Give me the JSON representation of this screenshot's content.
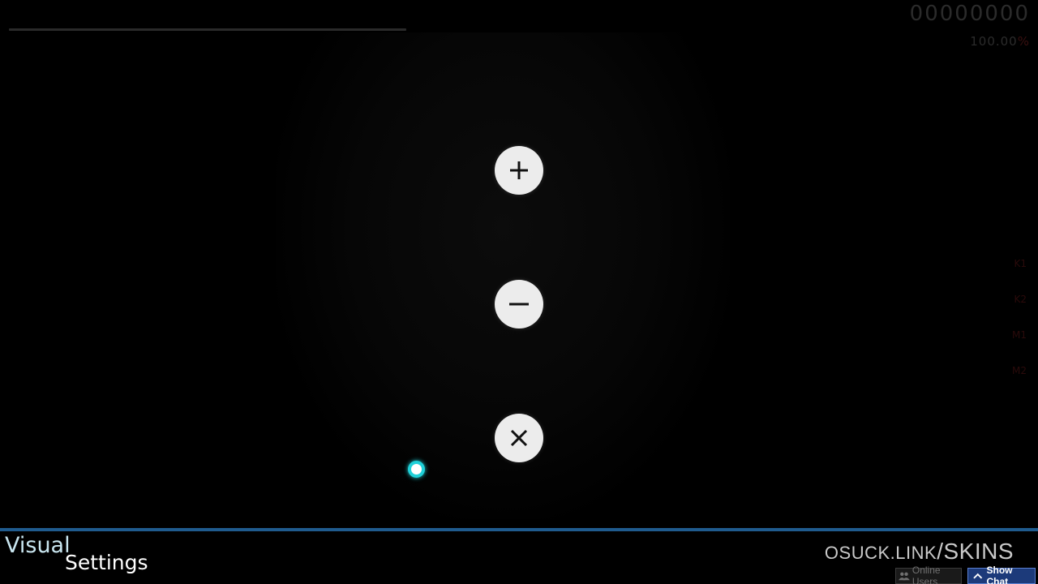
{
  "hud": {
    "score": "00000000",
    "accuracy_number": "100.00",
    "accuracy_symbol": "%",
    "progress_fraction": 0.0,
    "keys": [
      "K1",
      "K2",
      "M1",
      "M2"
    ]
  },
  "controls": {
    "buttons": [
      {
        "id": "plus",
        "icon": "plus-icon"
      },
      {
        "id": "minus",
        "icon": "minus-icon"
      },
      {
        "id": "close",
        "icon": "close-icon"
      }
    ]
  },
  "footer": {
    "title_line1": "Visual",
    "title_line2": "Settings",
    "brand_part1": "OSUCK.LINK",
    "brand_part2": "/SKINS",
    "online_users_label": "Online Users",
    "show_chat_label": "Show Chat"
  },
  "colors": {
    "accent_bar": "#1f5b8e",
    "cursor_ring": "#1fd0d8",
    "show_chat_bg": "#1c3a7a"
  }
}
